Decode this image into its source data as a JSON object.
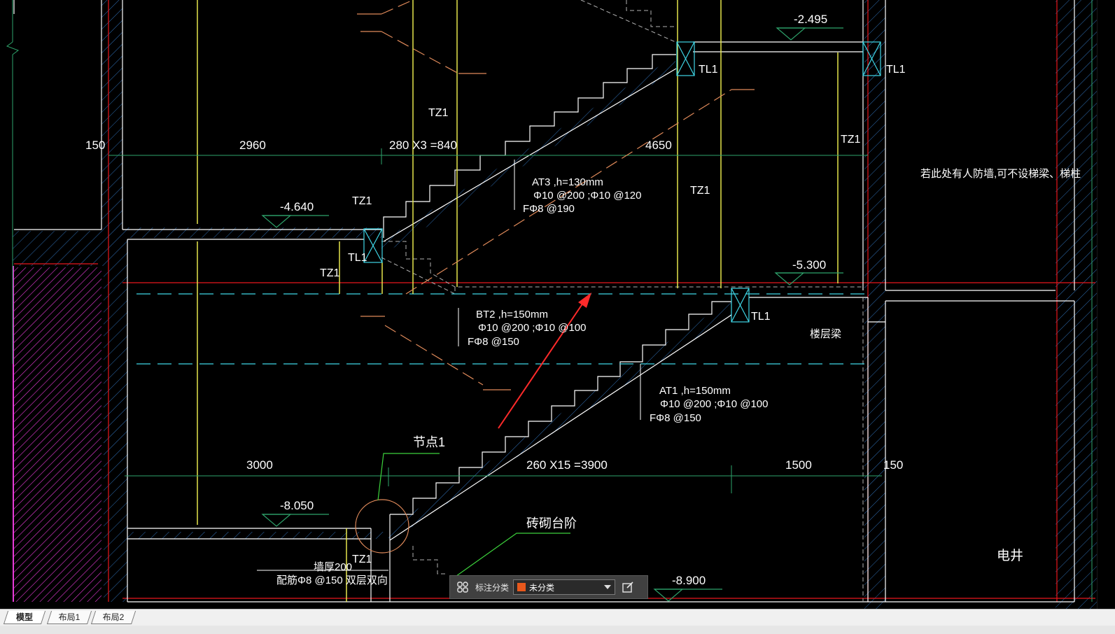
{
  "drawing": {
    "dims": {
      "d150_left": "150",
      "d2960": "2960",
      "d280x3": "280 X3 =840",
      "d4650": "4650",
      "d3000": "3000",
      "d260x15": "260 X15 =3900",
      "d1500": "1500",
      "d150_right": "150"
    },
    "elevations": {
      "e_m2495": "-2.495",
      "e_m4640": "-4.640",
      "e_m5300": "-5.300",
      "e_m8050": "-8.050",
      "e_m8900": "-8.900"
    },
    "labels": {
      "tl1_a": "TL1",
      "tl1_b": "TL1",
      "tl1_c": "TL1",
      "tl1_d": "TL1",
      "tz1_a": "TZ1",
      "tz1_b": "TZ1",
      "tz1_c": "TZ1",
      "tz1_d": "TZ1",
      "tz1_e": "TZ1",
      "tz1_f": "TZ1"
    },
    "stairs": {
      "at3_1": "AT3 ,h=130mm",
      "at3_2": "Φ10 @200 ;Φ10 @120",
      "at3_3": "FΦ8 @190",
      "bt2_1": "BT2 ,h=150mm",
      "bt2_2": "Φ10 @200 ;Φ10 @100",
      "bt2_3": "FΦ8 @150",
      "at1_1": "AT1 ,h=150mm",
      "at1_2": "Φ10 @200 ;Φ10 @100",
      "at1_3": "FΦ8 @150"
    },
    "notes": {
      "civil_defense": "若此处有人防墙,可不设梯梁、梯柱",
      "floor_beam": "楼层梁",
      "node1": "节点1",
      "brick_step": "砖砌台阶",
      "wall_thk": "墙厚200",
      "rebar": "配筋Φ8 @150 双层双向",
      "shaft": "电井"
    }
  },
  "toolbar": {
    "label": "标注分类",
    "dropdown_value": "未分类",
    "swatch_color": "#e8581c",
    "left_icon": "category-icon",
    "right_icon": "edit-icon"
  },
  "tabs": [
    "模型",
    "布局1",
    "布局2"
  ],
  "colors": {
    "background": "#000000",
    "wall": "#ffffff",
    "hatch": "#2f6fb5",
    "axis_red": "#e8161c",
    "column_yellow": "#e6e64c",
    "dim_green": "#2ea36b",
    "cyan": "#3fd6e6",
    "magenta": "#e83bd8",
    "leader_orange": "#e08a5a",
    "arrow_red": "#ff2a2a"
  }
}
